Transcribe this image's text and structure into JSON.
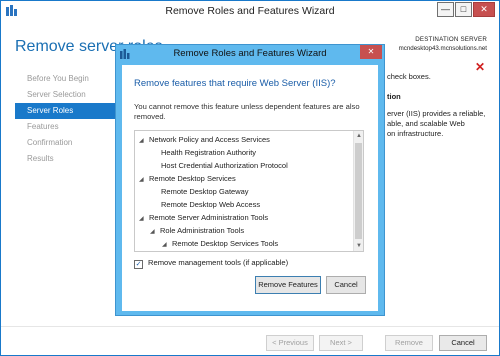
{
  "window": {
    "title": "Remove Roles and Features Wizard",
    "min_glyph": "—",
    "max_glyph": "□",
    "close_glyph": "✕"
  },
  "page": {
    "title": "Remove server roles",
    "destination_label": "DESTINATION SERVER",
    "destination_server": "mcndesktop43.mcnsolutions.net"
  },
  "nav": {
    "items": [
      {
        "label": "Before You Begin",
        "active": false
      },
      {
        "label": "Server Selection",
        "active": false
      },
      {
        "label": "Server Roles",
        "active": true
      },
      {
        "label": "Features",
        "active": false
      },
      {
        "label": "Confirmation",
        "active": false
      },
      {
        "label": "Results",
        "active": false
      }
    ]
  },
  "background_content": {
    "line1": "check boxes.",
    "heading": "tion",
    "desc1": "erver (IIS) provides a reliable,",
    "desc2": "able, and scalable Web",
    "desc3": "on infrastructure."
  },
  "footer": {
    "previous": "< Previous",
    "next": "Next >",
    "remove": "Remove",
    "cancel": "Cancel"
  },
  "dialog": {
    "title": "Remove Roles and Features Wizard",
    "close_glyph": "✕",
    "heading": "Remove features that require Web Server (IIS)?",
    "message": "You cannot remove this feature unless dependent features are also removed.",
    "tree": [
      {
        "label": "Network Policy and Access Services",
        "level": 0,
        "expander": "◢"
      },
      {
        "label": "Health Registration Authority",
        "level": 1,
        "expander": ""
      },
      {
        "label": "Host Credential Authorization Protocol",
        "level": 1,
        "expander": ""
      },
      {
        "label": "Remote Desktop Services",
        "level": 0,
        "expander": "◢"
      },
      {
        "label": "Remote Desktop Gateway",
        "level": 1,
        "expander": ""
      },
      {
        "label": "Remote Desktop Web Access",
        "level": 1,
        "expander": ""
      },
      {
        "label": "Remote Server Administration Tools",
        "level": 0,
        "expander": "◢"
      },
      {
        "label": "Role Administration Tools",
        "level": 1,
        "expander": "◢"
      },
      {
        "label": "Remote Desktop Services Tools",
        "level": 2,
        "expander": "◢"
      }
    ],
    "checkbox_label": "Remove management tools (if applicable)",
    "checkbox_checked": true,
    "remove_features_button": "Remove Features",
    "cancel_button": "Cancel"
  },
  "colors": {
    "accent": "#1979ca",
    "dialog_frame": "#5fb9ee",
    "heading": "#1a5da8",
    "close_red": "#c75050"
  }
}
